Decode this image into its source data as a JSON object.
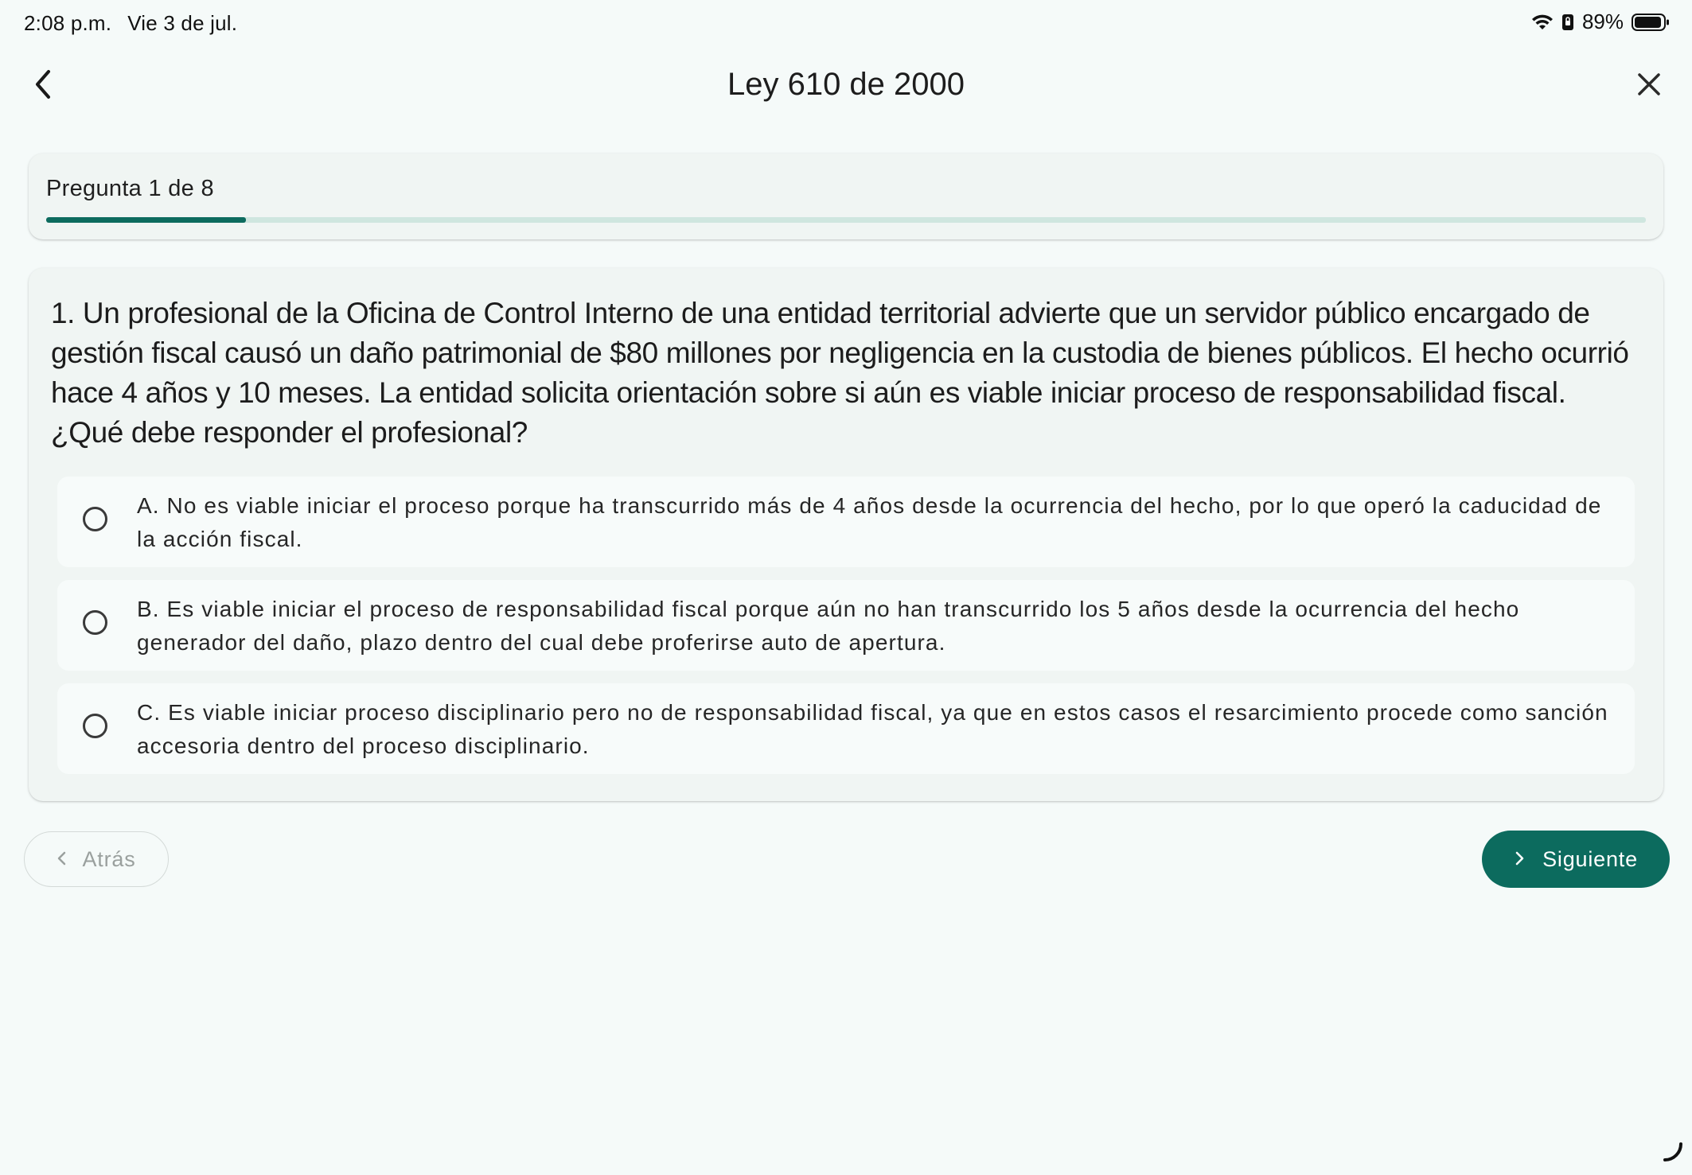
{
  "status_bar": {
    "time": "2:08 p.m.",
    "date": "Vie 3 de jul.",
    "battery": "89%",
    "icons": [
      "wifi-icon",
      "lock-rotation-icon",
      "battery-icon"
    ]
  },
  "header": {
    "title": "Ley 610 de 2000",
    "back_icon": "chevron-left-icon",
    "close_icon": "close-icon"
  },
  "progress": {
    "label": "Pregunta 1 de 8",
    "current": 1,
    "total": 8,
    "fraction": 0.125
  },
  "question": {
    "text": "1. Un profesional de la Oficina de Control Interno de una entidad territorial advierte que un servidor público encargado de gestión fiscal causó un daño patrimonial de $80 millones por negligencia en la custodia de bienes públicos. El hecho ocurrió hace 4 años y 10 meses. La entidad solicita orientación sobre si aún es viable iniciar proceso de responsabilidad fiscal. ¿Qué debe responder el profesional?",
    "options": [
      {
        "text": "A. No es viable iniciar el proceso porque ha transcurrido más de 4 años desde la ocurrencia del hecho, por lo que operó la caducidad de la acción fiscal.",
        "selected": false
      },
      {
        "text": "B. Es viable iniciar el proceso de responsabilidad fiscal porque aún no han transcurrido los 5 años desde la ocurrencia del hecho generador del daño, plazo dentro del cual debe proferirse auto de apertura.",
        "selected": false
      },
      {
        "text": "C. Es viable iniciar proceso disciplinario pero no de responsabilidad fiscal, ya que en estos casos el resarcimiento procede como sanción accesoria dentro del proceso disciplinario.",
        "selected": false
      }
    ]
  },
  "navigation": {
    "back_label": "Atrás",
    "next_label": "Siguiente"
  },
  "colors": {
    "accent": "#0c6b5e",
    "track": "#cfe6df",
    "background": "#f5faf9",
    "card": "#f0f5f3"
  }
}
